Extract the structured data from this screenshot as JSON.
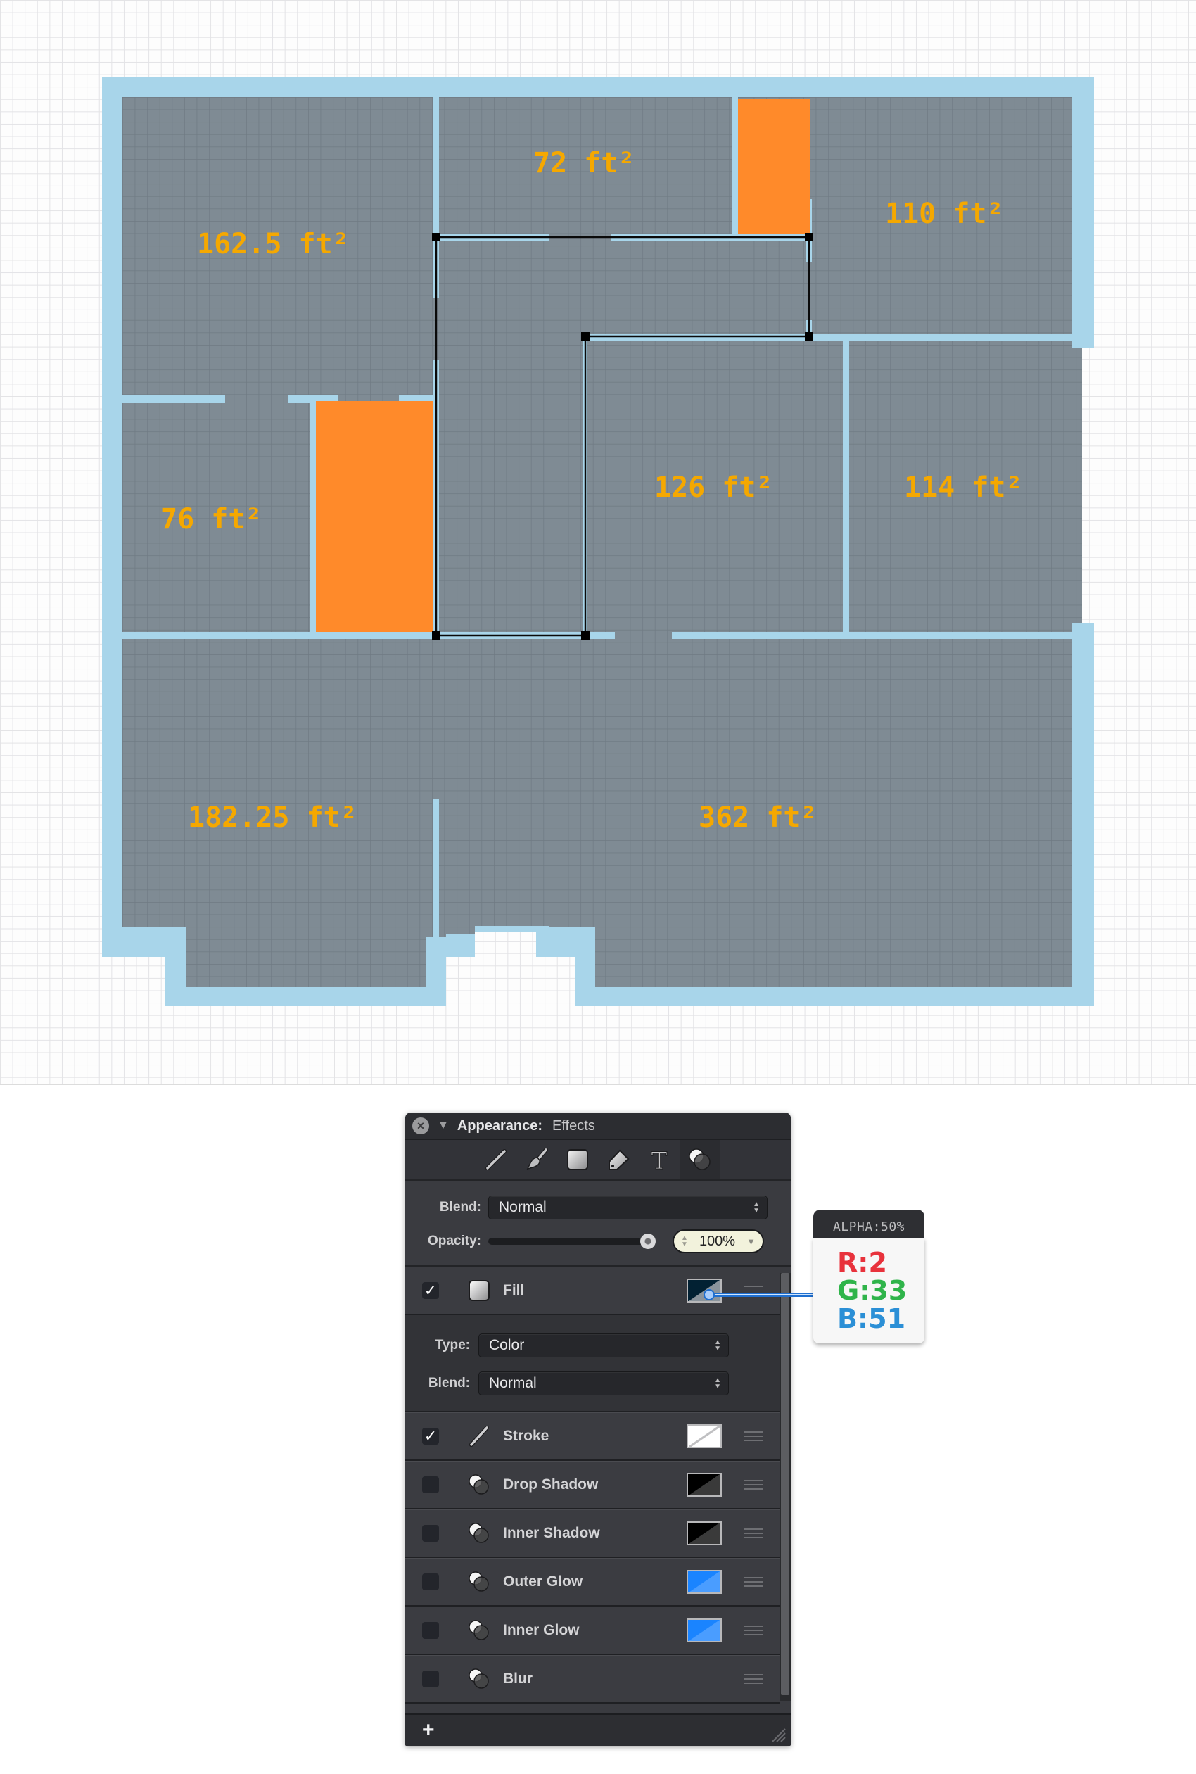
{
  "floor_plan": {
    "rooms": [
      {
        "label": "162.5 ft²"
      },
      {
        "label": "72 ft²"
      },
      {
        "label": "110 ft²"
      },
      {
        "label": "76 ft²"
      },
      {
        "label": "126 ft²"
      },
      {
        "label": "114 ft²"
      },
      {
        "label": "182.25 ft²"
      },
      {
        "label": "362 ft²"
      }
    ],
    "colors": {
      "wall": "#a8d5ea",
      "floor": "#7f8b94",
      "highlight": "#ff8a2a",
      "label": "#f5a800",
      "selection": "#000000"
    }
  },
  "panel": {
    "title": "Appearance:",
    "subtitle": "Effects",
    "close_icon": "close-icon",
    "toolbar_tools": [
      "stroke-tool",
      "brush-tool",
      "fill-tool",
      "tag-tool",
      "text-tool",
      "effects-tool"
    ],
    "blend_label": "Blend:",
    "blend_value": "Normal",
    "opacity_label": "Opacity:",
    "opacity_value": "100%",
    "opacity_fraction": 1.0,
    "fill": {
      "label": "Fill",
      "checked": true,
      "type_label": "Type:",
      "type_value": "Color",
      "blend_label": "Blend:",
      "blend_value": "Normal"
    },
    "effects": [
      {
        "label": "Stroke",
        "checked": true,
        "swatch": "white"
      },
      {
        "label": "Drop Shadow",
        "checked": false,
        "swatch": "black"
      },
      {
        "label": "Inner Shadow",
        "checked": false,
        "swatch": "black"
      },
      {
        "label": "Outer Glow",
        "checked": false,
        "swatch": "#1a84ff"
      },
      {
        "label": "Inner Glow",
        "checked": false,
        "swatch": "#1a84ff"
      },
      {
        "label": "Blur",
        "checked": false,
        "swatch": null
      }
    ],
    "add_label": "+"
  },
  "color_tooltip": {
    "alpha": "ALPHA:50%",
    "r": "R:2",
    "g": "G:33",
    "b": "B:51",
    "r_color": "#e8323c",
    "g_color": "#2fb44a",
    "b_color": "#2b8fd6"
  }
}
